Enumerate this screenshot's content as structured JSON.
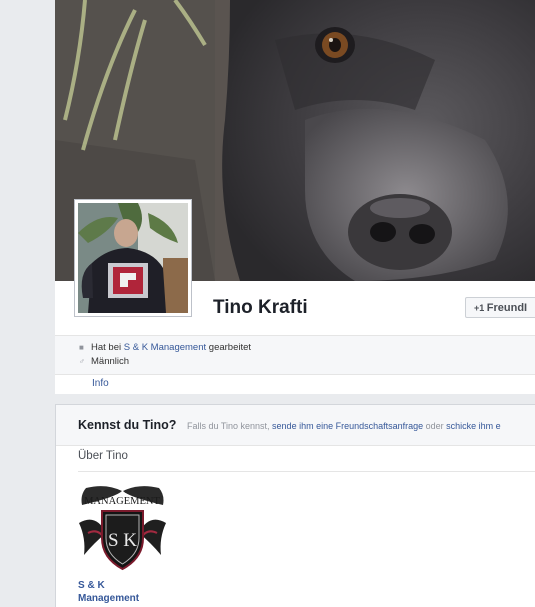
{
  "profile": {
    "name": "Tino Krafti",
    "friend_button_label": "FreundI",
    "friend_button_icon": "add-friend-icon"
  },
  "facts": {
    "work_prefix": "Hat bei ",
    "work_link": "S & K Management",
    "work_suffix": " gearbeitet",
    "gender": "Männlich"
  },
  "tabs": {
    "info": "Info"
  },
  "know_panel": {
    "title": "Kennst du Tino?",
    "text_1": "Falls du Tino kennst, ",
    "link_1": "sende ihm eine Freundschaftsanfrage",
    "text_2": " oder ",
    "link_2": "schicke ihm e"
  },
  "about": {
    "heading": "Über Tino",
    "logo_text": "MANAGEMENT",
    "logo_initials": "S K",
    "work_name_line1": "S & K",
    "work_name_line2": "Management"
  },
  "colors": {
    "link": "#365899",
    "background": "#e9ebee",
    "header_text": "#1d2129"
  }
}
